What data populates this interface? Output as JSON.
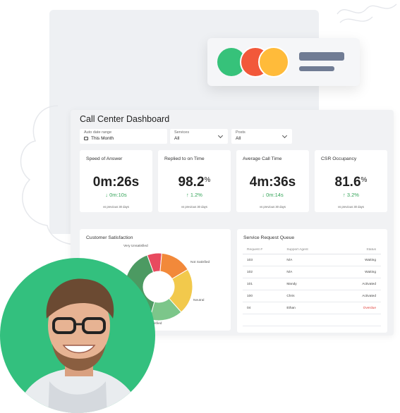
{
  "dashboard": {
    "title": "Call Center Dashboard",
    "filters": [
      {
        "label": "Auto date range",
        "value": "This Month",
        "icon": "calendar-icon"
      },
      {
        "label": "Services",
        "value": "All",
        "icon": "chevron-down-icon"
      },
      {
        "label": "Posts",
        "value": "All",
        "icon": "chevron-down-icon"
      }
    ],
    "kpis": [
      {
        "title": "Speed of Answer",
        "value": "0m:26s",
        "unit": "",
        "delta": "↓ 0m:10s",
        "footnote": "vs previous 30 days"
      },
      {
        "title": "Replied to on Time",
        "value": "98.2",
        "unit": "%",
        "delta": "↑ 1.2%",
        "footnote": "vs previous 30 days"
      },
      {
        "title": "Average Call Time",
        "value": "4m:36s",
        "unit": "",
        "delta": "↓ 0m:14s",
        "footnote": "vs previous 30 days"
      },
      {
        "title": "CSR Occupancy",
        "value": "81.6",
        "unit": "%",
        "delta": "↑ 3.2%",
        "footnote": "vs previous 30 days"
      }
    ],
    "satisfaction": {
      "title": "Customer Satisfaction",
      "labels": [
        "Very Unsatisfied",
        "Not Satisfied",
        "Neutral",
        "Satisfied"
      ]
    },
    "queue": {
      "title": "Service Request Queue",
      "columns": [
        "Request #",
        "Support Agent",
        "Status"
      ],
      "rows": [
        [
          "103",
          "N/A",
          "Waiting"
        ],
        [
          "102",
          "N/A",
          "Waiting"
        ],
        [
          "101",
          "Mandy",
          "Activated"
        ],
        [
          "100",
          "Chris",
          "Activated"
        ],
        [
          "04",
          "Ethan",
          "Overdue"
        ]
      ]
    }
  },
  "colors": {
    "accent_green": "#33c07e",
    "dot_red": "#f2583a",
    "dot_orange": "#ffbb3a",
    "delta_green": "#36a55a",
    "overdue_red": "#e0403a"
  },
  "chart_data": {
    "type": "pie",
    "donut": true,
    "series": [
      {
        "name": "Very Unsatisfied",
        "value": 7,
        "color": "#e84a5f"
      },
      {
        "name": "Not Satisfied",
        "value": 15,
        "color": "#f2893a"
      },
      {
        "name": "Neutral",
        "value": 22,
        "color": "#f2c94c"
      },
      {
        "name": "Satisfied",
        "value": 16,
        "color": "#7cc68a"
      },
      {
        "name": "",
        "value": 40,
        "color": "#4c9a62"
      }
    ],
    "legend": "labels-on-slices"
  }
}
